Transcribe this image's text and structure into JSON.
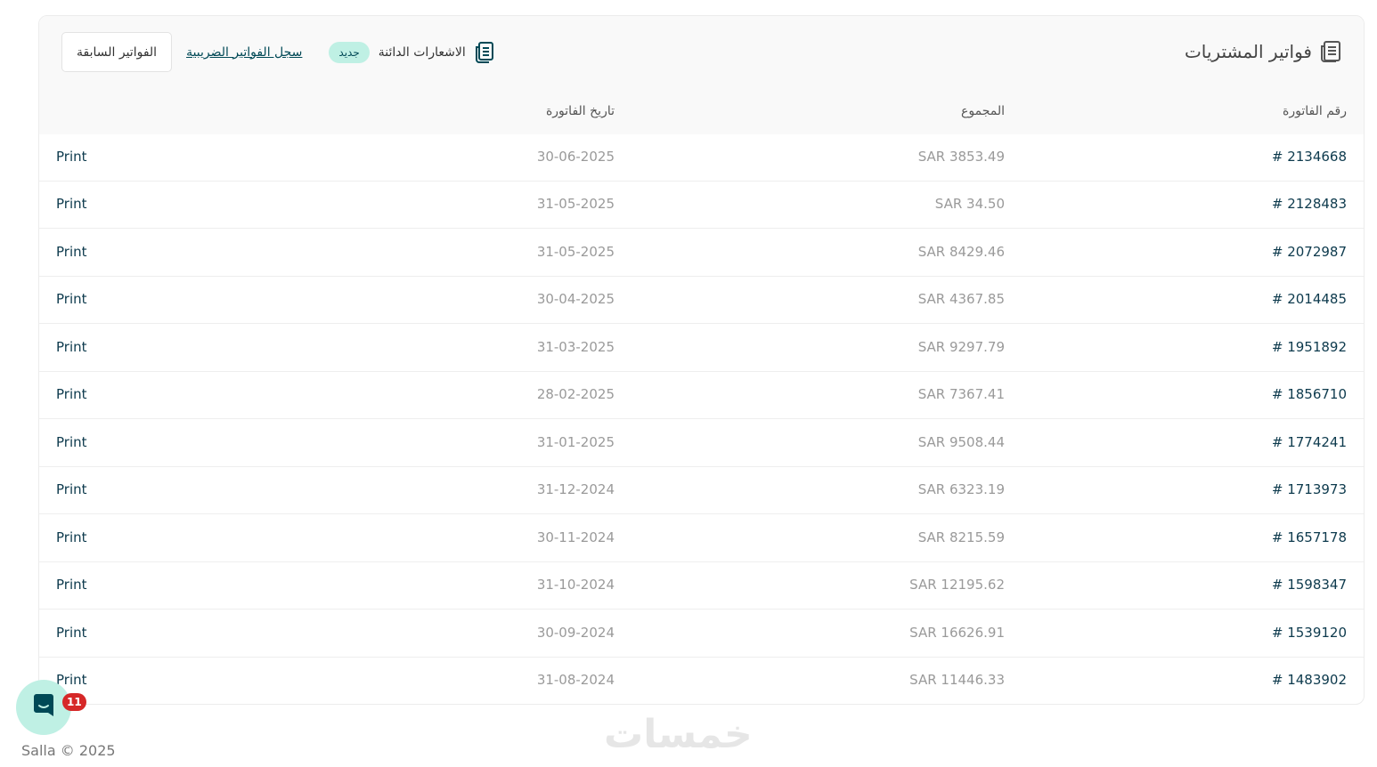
{
  "page": {
    "title": "فواتير المشتريات",
    "actions": {
      "previous_invoices": "الفواتير السابقة",
      "tax_invoices_log": "سجل الفواتير الضريبية",
      "new_badge": "جديد",
      "credit_notes": "الاشعارات الدائنة"
    }
  },
  "table": {
    "headers": {
      "number": "رقم الفاتورة",
      "total": "المجموع",
      "date": "تاريخ الفاتورة"
    },
    "rows": [
      {
        "number": "# 2134668",
        "total": "SAR 3853.49",
        "date": "30-06-2025",
        "action": "Print"
      },
      {
        "number": "# 2128483",
        "total": "SAR 34.50",
        "date": "31-05-2025",
        "action": "Print"
      },
      {
        "number": "# 2072987",
        "total": "SAR 8429.46",
        "date": "31-05-2025",
        "action": "Print"
      },
      {
        "number": "# 2014485",
        "total": "SAR 4367.85",
        "date": "30-04-2025",
        "action": "Print"
      },
      {
        "number": "# 1951892",
        "total": "SAR 9297.79",
        "date": "31-03-2025",
        "action": "Print"
      },
      {
        "number": "# 1856710",
        "total": "SAR 7367.41",
        "date": "28-02-2025",
        "action": "Print"
      },
      {
        "number": "# 1774241",
        "total": "SAR 9508.44",
        "date": "31-01-2025",
        "action": "Print"
      },
      {
        "number": "# 1713973",
        "total": "SAR 6323.19",
        "date": "31-12-2024",
        "action": "Print"
      },
      {
        "number": "# 1657178",
        "total": "SAR 8215.59",
        "date": "30-11-2024",
        "action": "Print"
      },
      {
        "number": "# 1598347",
        "total": "SAR 12195.62",
        "date": "31-10-2024",
        "action": "Print"
      },
      {
        "number": "# 1539120",
        "total": "SAR 16626.91",
        "date": "30-09-2024",
        "action": "Print"
      },
      {
        "number": "# 1483902",
        "total": "SAR 11446.33",
        "date": "31-08-2024",
        "action": "Print"
      }
    ]
  },
  "watermark": "خمسات",
  "chat": {
    "badge_count": "11",
    "icon": "chat-icon"
  },
  "footer": {
    "text": "Salla © 2025"
  },
  "colors": {
    "accent": "#004956",
    "accent_light": "#bff0e4",
    "badge_red": "#d62828"
  }
}
